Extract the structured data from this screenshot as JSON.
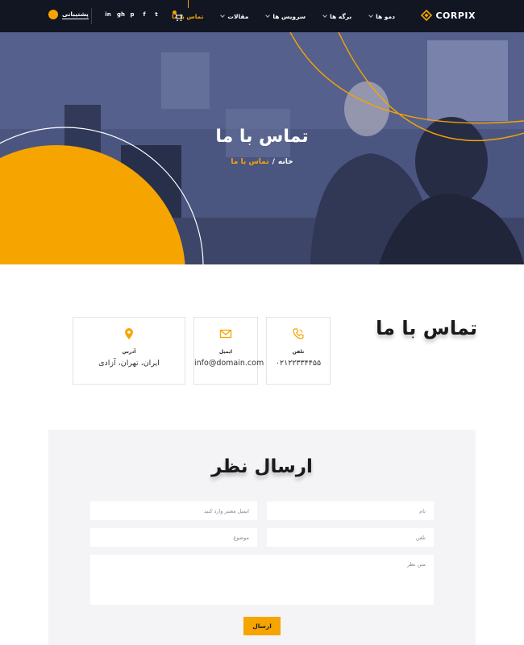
{
  "nav": {
    "logo_text": "CORPIX",
    "menu": [
      {
        "label": "دمو ها",
        "has_dropdown": true,
        "active": false
      },
      {
        "label": "برگه ها",
        "has_dropdown": true,
        "active": false
      },
      {
        "label": "سرویس ها",
        "has_dropdown": true,
        "active": false
      },
      {
        "label": "مقالات",
        "has_dropdown": true,
        "active": false
      },
      {
        "label": "تماس با ما",
        "has_dropdown": false,
        "active": true
      }
    ],
    "social_icons": [
      "twitter-icon",
      "facebook-icon",
      "pinterest-icon",
      "github-icon",
      "linkedin-icon"
    ],
    "social_glyphs": [
      "in",
      "gh",
      "p",
      "f",
      "t"
    ],
    "support_label": "پشتیبانی"
  },
  "hero": {
    "title": "تماس با ما",
    "breadcrumb_home": "خانه",
    "breadcrumb_sep": "/",
    "breadcrumb_current": "تماس با ما"
  },
  "contact": {
    "title": "تماس با ما",
    "cards": [
      {
        "label": "تلفن",
        "value": "۰۲۱۲۲۳۳۴۴۵۵",
        "icon": "phone-icon"
      },
      {
        "label": "ایمیل",
        "value": "info@domain.com",
        "icon": "mail-icon"
      },
      {
        "label": "آدرس",
        "value": "ایران، تهران، آزادی",
        "icon": "location-pin-icon"
      }
    ]
  },
  "form": {
    "title": "ارسال نظر",
    "name_placeholder": "نام",
    "email_placeholder": "ایمیل معتبر وارد کنید",
    "phone_placeholder": "تلفن",
    "subject_placeholder": "موضوع",
    "message_placeholder": "متن نظر",
    "submit_label": "ارسال"
  },
  "colors": {
    "nav_bg": "#121522",
    "accent": "#f6a500",
    "hero_overlay": "#4a557d",
    "form_bg": "#f4f4f6"
  }
}
